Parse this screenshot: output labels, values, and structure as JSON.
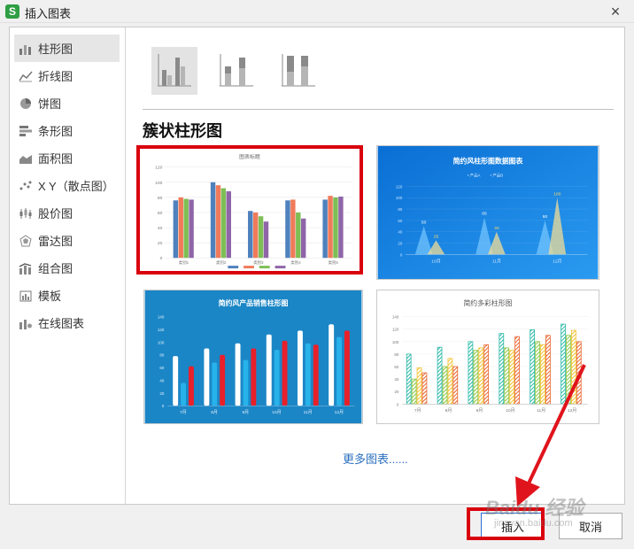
{
  "window": {
    "title": "插入图表",
    "app_icon_letter": "S",
    "close_glyph": "×"
  },
  "sidebar": {
    "items": [
      {
        "label": "柱形图",
        "icon": "column-chart-icon",
        "active": true
      },
      {
        "label": "折线图",
        "icon": "line-chart-icon"
      },
      {
        "label": "饼图",
        "icon": "pie-chart-icon"
      },
      {
        "label": "条形图",
        "icon": "bar-chart-icon"
      },
      {
        "label": "面积图",
        "icon": "area-chart-icon"
      },
      {
        "label": "X Y（散点图）",
        "icon": "scatter-chart-icon"
      },
      {
        "label": "股价图",
        "icon": "stock-chart-icon"
      },
      {
        "label": "雷达图",
        "icon": "radar-chart-icon"
      },
      {
        "label": "组合图",
        "icon": "combo-chart-icon"
      },
      {
        "label": "模板",
        "icon": "template-icon"
      },
      {
        "label": "在线图表",
        "icon": "online-chart-icon"
      }
    ]
  },
  "subtypes": [
    "clustered-column-icon",
    "stacked-column-icon",
    "percent-stacked-column-icon"
  ],
  "section_title": "簇状柱形图",
  "templates": {
    "t1": {
      "title": "图表标题",
      "y_ticks": [
        "120",
        "100",
        "80",
        "60",
        "40",
        "20",
        "0"
      ],
      "categories": [
        "类别1",
        "类别2",
        "类别3",
        "类别4",
        "类别5"
      ],
      "values": [
        [
          76,
          80,
          78,
          77
        ],
        [
          100,
          96,
          92,
          88
        ],
        [
          62,
          60,
          55,
          48
        ],
        [
          76,
          77,
          60,
          52
        ],
        [
          77,
          82,
          80,
          81
        ]
      ],
      "colors": [
        "#4f81bd",
        "#f07b5a",
        "#7ebf55",
        "#8f65a8"
      ]
    },
    "t2": {
      "title": "简约风柱形图数据图表",
      "legend": [
        "产品A",
        "产品B"
      ],
      "y_ticks": [
        "120",
        "100",
        "80",
        "60",
        "40",
        "20",
        "0"
      ],
      "categories": [
        "10月",
        "11月",
        "12月"
      ],
      "series_a": [
        50,
        65,
        60
      ],
      "series_b": [
        25,
        40,
        100
      ]
    },
    "t3": {
      "title": "简约风产品销售柱形图",
      "y_ticks": [
        "140",
        "120",
        "100",
        "80",
        "60",
        "40",
        "20",
        "0"
      ],
      "categories": [
        "7月",
        "8月",
        "9月",
        "10月",
        "11月",
        "12月"
      ],
      "white": [
        78,
        90,
        98,
        112,
        118,
        128
      ],
      "blue": [
        36,
        68,
        72,
        88,
        98,
        108
      ],
      "red": [
        62,
        80,
        90,
        102,
        96,
        118
      ]
    },
    "t4": {
      "title": "简约多彩柱形图",
      "y_ticks": [
        "140",
        "120",
        "100",
        "80",
        "60",
        "40",
        "20",
        "0"
      ],
      "categories": [
        "7月",
        "8月",
        "9月",
        "10月",
        "11月",
        "12月"
      ],
      "series": [
        [
          80,
          91,
          100,
          113,
          119,
          128
        ],
        [
          40,
          60,
          86,
          90,
          100,
          110
        ],
        [
          58,
          73,
          90,
          86,
          95,
          118
        ],
        [
          50,
          60,
          95,
          108,
          110,
          100
        ]
      ],
      "colors": [
        "#29b8a6",
        "#8bc53f",
        "#f2c12e",
        "#e8622c"
      ]
    }
  },
  "more_link": "更多图表......",
  "buttons": {
    "insert": "插入",
    "cancel": "取消"
  },
  "watermark": {
    "main": "Baidu 经验",
    "sub": "jingyan.baidu.com"
  },
  "highlight_color": "#d9000d"
}
